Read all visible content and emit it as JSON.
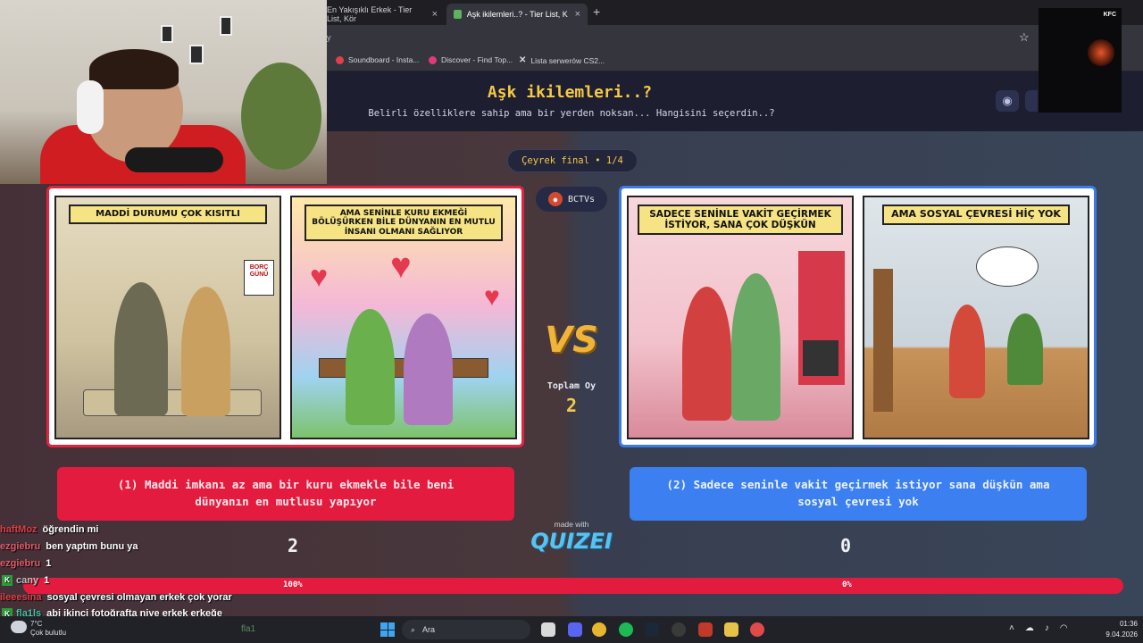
{
  "browser": {
    "tabs": [
      {
        "label": "En Yakışıklı Erkek - Tier List, Kör",
        "active": false
      },
      {
        "label": "Aşk ikilemleri..? - Tier List, Kör S",
        "active": true
      }
    ],
    "url": "y",
    "bookmarks": [
      "Soundboard - Insta...",
      "Discover - Find Top...",
      "Lista serwerów CS2..."
    ]
  },
  "page": {
    "title": "Aşk ikilemleri..?",
    "subtitle": "Belirli özelliklere sahip ama bir yerden noksan... Hangisini seçerdin..?",
    "round": "Çeyrek final • 1/4",
    "creator": "BCTVs",
    "vs": "VS",
    "total_label": "Toplam Oy",
    "total_votes": "2",
    "left": {
      "panel1_caption": "MADDİ DURUMU ÇOK KISITLI",
      "panel2_caption": "AMA SENİNLE KURU EKMEĞİ BÖLÜŞÜRKEN BİLE DÜNYANIN EN MUTLU İNSANI OLMANI SAĞLIYOR",
      "calendar_label": "BORÇ GÜNÜ",
      "option_text": "(1) Maddi imkanı az ama bir kuru ekmekle bile beni dünyanın en mutlusu yapıyor",
      "votes": "2",
      "percent": "100%",
      "share": 1.0
    },
    "right": {
      "panel1_caption": "SADECE SENİNLE VAKİT GEÇİRMEK İSTİYOR, SANA ÇOK DÜŞKÜN",
      "panel2_caption": "AMA SOSYAL ÇEVRESİ HİÇ YOK",
      "option_text": "(2) Sadece seninle vakit geçirmek istiyor sana düşkün ama sosyal çevresi yok",
      "votes": "0",
      "percent": "0%",
      "share": 0.0
    },
    "made_with": "made with",
    "brand": "QUIZEI"
  },
  "stream": {
    "mini_cam_logo": "KFC",
    "chat": [
      {
        "user": "haftMoz",
        "user_color": "#e0404a",
        "text": "öğrendin mi",
        "badge": false
      },
      {
        "user": "ezgiebru",
        "user_color": "#e05a6a",
        "text": "ben yaptım bunu ya",
        "badge": false
      },
      {
        "user": "ezgiebru",
        "user_color": "#e05a6a",
        "text": "1",
        "badge": false
      },
      {
        "user": "cany",
        "user_color": "#b0b0b0",
        "text": "1",
        "badge": true
      },
      {
        "user": "ileeesina",
        "user_color": "#e0404a",
        "text": "sosyal çevresi olmayan erkek çok yorar",
        "badge": false
      },
      {
        "user": "fla1ls",
        "user_color": "#46c2a8",
        "text": "abi ikinci fotoğrafta niye erkek erkeğe",
        "badge": true
      }
    ]
  },
  "taskbar": {
    "temperature": "7°C",
    "weather": "Çok bulutlu",
    "search_placeholder": "Ara",
    "ghost_text": "fla1",
    "time": "01:36",
    "date": "9.04.2026"
  },
  "colors": {
    "left_accent": "#e31b3f",
    "right_accent": "#3b7ff0",
    "title": "#f6c945"
  }
}
